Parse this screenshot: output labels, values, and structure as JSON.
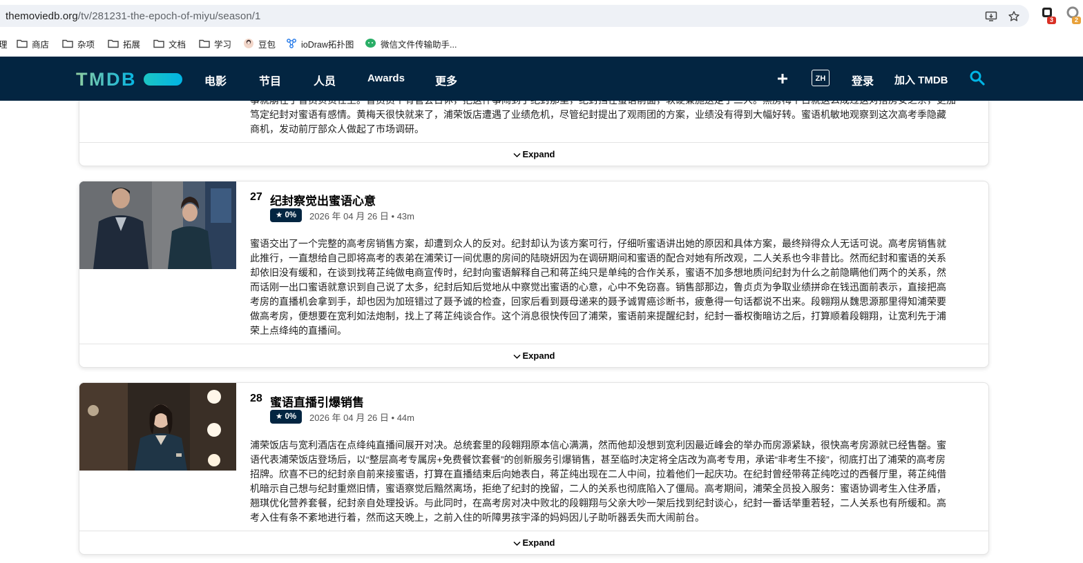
{
  "browser": {
    "url_host": "themoviedb.org",
    "url_path": "/tv/281231-the-epoch-of-miyu/season/1",
    "ext_badge_1": "3",
    "ext_badge_2": "2",
    "bookmarks": [
      {
        "label": "商店",
        "icon": "folder-icon"
      },
      {
        "label": "杂项",
        "icon": "folder-icon"
      },
      {
        "label": "拓展",
        "icon": "folder-icon"
      },
      {
        "label": "文档",
        "icon": "folder-icon"
      },
      {
        "label": "学习",
        "icon": "folder-icon"
      },
      {
        "label": "豆包",
        "icon": "doubao-icon"
      },
      {
        "label": "ioDraw拓扑图",
        "icon": "topology-icon"
      },
      {
        "label": "微信文件传输助手...",
        "icon": "wechat-icon"
      }
    ],
    "bookmark_partial": "理"
  },
  "nav": {
    "logo": "TMDB",
    "links": [
      "电影",
      "节目",
      "人员",
      "Awards",
      "更多"
    ],
    "lang": "ZH",
    "login": "登录",
    "join": "加入 TMDB"
  },
  "episodes": [
    {
      "overview_lines": [
        "事就崩在了督员负责任上。督员员个有管会日休，把这件事闹到了纪封那里，纪封挡在蜜语前面，软硬兼施送走了二人。黑房梅个日就这么成过这对搭房安之余，更加",
        "笃定纪封对蜜语有感情。黄梅天很快就来了，浦荣饭店遭遇了业绩危机，尽管纪封提出了观雨团的方案，业绩没有得到大幅好转。蜜语机敏地观察到这次高考季隐藏",
        "商机，发动前厅部众人做起了市场调研。"
      ],
      "expand": "Expand"
    },
    {
      "number": "27",
      "title": "纪封察觉出蜜语心意",
      "rating": "★ 0%",
      "date": "2026 年 04 月 26 日",
      "runtime": "43m",
      "overview_lines": [
        "蜜语交出了一个完整的高考房销售方案，却遭到众人的反对。纪封却认为该方案可行，仔细听蜜语讲出她的原因和具体方案，最终辩得众人无话可说。高考房销售就",
        "此推行，一直想给自己即将高考的表弟在浦荣订一间优惠的房间的陆晓妍因为在调研期间和蜜语的配合对她有所改观，二人关系也今非昔比。然而纪封和蜜语的关系",
        "却依旧没有缓和，在谈到找蒋芷纯做电商宣传时，纪封向蜜语解释自己和蒋芷纯只是单纯的合作关系，蜜语不加多想地质问纪封为什么之前隐瞒他们两个的关系，然",
        "而话刚一出口蜜语就意识到自己说了太多，纪封后知后觉地从中察觉出蜜语的心意，心中不免窃喜。销售部那边，鲁贞贞为争取业绩拼命在钱迅面前表示，直接把高",
        "考房的直播机会拿到手，却也因为加班错过了聂予诚的检查，回家后看到聂母递来的聂予诚胃癌诊断书，疲惫得一句话都说不出来。段翱翔从魏思源那里得知浦荣要",
        "做高考房，便想要在宽利如法炮制，找上了蒋芷纯谈合作。这个消息很快传回了浦荣，蜜语前来提醒纪封，纪封一番权衡暗访之后，打算顺着段翱翔，让宽利先于浦",
        "荣上点绛纯的直播间。"
      ],
      "expand": "Expand"
    },
    {
      "number": "28",
      "title": "蜜语直播引爆销售",
      "rating": "★ 0%",
      "date": "2026 年 04 月 26 日",
      "runtime": "44m",
      "overview_lines": [
        "浦荣饭店与宽利酒店在点绛纯直播间展开对决。总统套里的段翱翔原本信心满满，然而他却没想到宽利因最近峰会的举办而房源紧缺，很快高考房源就已经售罄。蜜",
        "语代表浦荣饭店登场后，以“整层高考专属房+免费餐饮套餐”的创新服务引爆销售，甚至临时决定将全店改为高考专用，承诺“非考生不接”，彻底打出了浦荣的高考房",
        "招牌。欣喜不已的纪封亲自前来接蜜语，打算在直播结束后向她表白，蒋芷纯出现在二人中间，拉着他们一起庆功。在纪封曾经带蒋芷纯吃过的西餐厅里，蒋芷纯借",
        "机暗示自己想与纪封重燃旧情，蜜语察觉后黯然离场，拒绝了纪封的挽留，二人的关系也彻底陷入了僵局。高考期间，浦荣全员投入服务：蜜语协调考生入住矛盾，",
        "翘琪优化营养套餐，纪封亲自处理投诉。与此同时，在高考房对决中败北的段翱翔与父亲大吵一架后找到纪封谈心，纪封一番话举重若轻，二人关系也有所缓和。高",
        "考入住有条不紊地进行着，然而这天晚上，之前入住的听障男孩宇泽的妈妈因儿子助听器丢失而大闹前台。"
      ],
      "expand": "Expand"
    }
  ]
}
